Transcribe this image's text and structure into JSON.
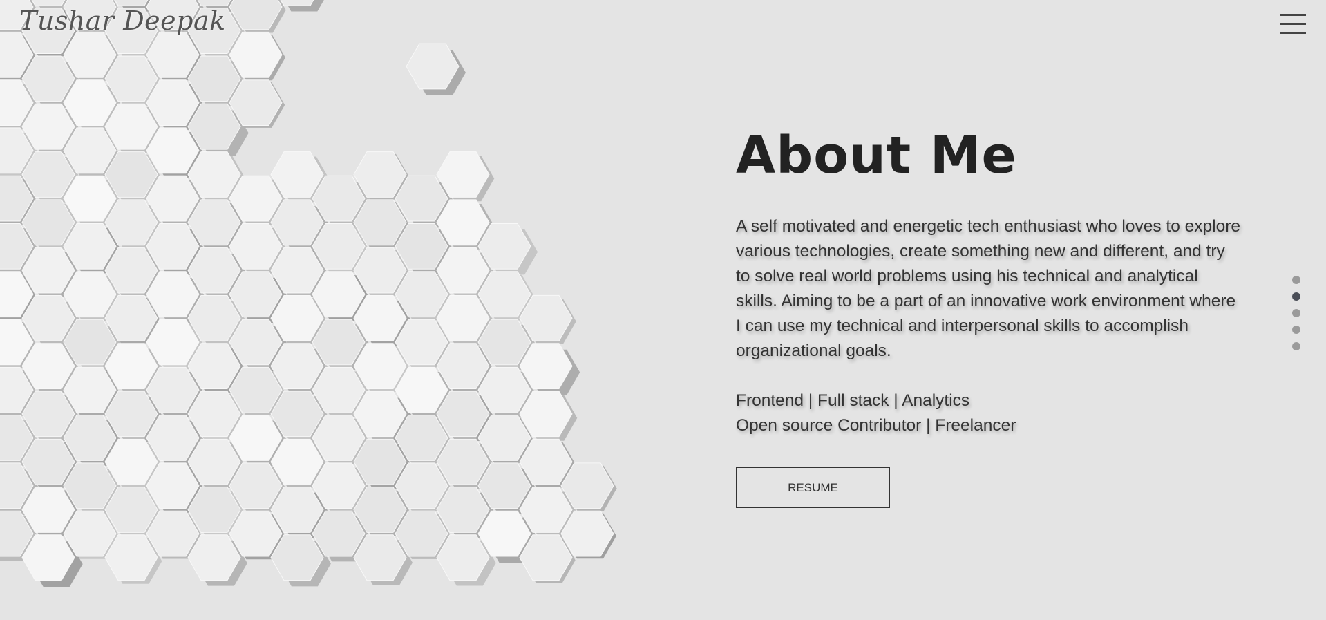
{
  "header": {
    "logo_text": "Tushar Deepak",
    "menu_icon": "hamburger-menu-icon"
  },
  "about": {
    "title": "About Me",
    "bio": "A self motivated and energetic tech enthusiast who loves to explore various technologies, create something new and different, and try to solve real world problems using his technical and analytical skills. Aiming to be a part of an innovative work environment where I can use my technical and interpersonal skills to accomplish organizational goals.",
    "roles": [
      "Frontend | Full stack | Analytics",
      "Open source Contributor | Freelancer"
    ],
    "resume_label": "RESUME"
  },
  "section_nav": {
    "count": 5,
    "active_index": 1
  },
  "colors": {
    "background": "#e4e4e4",
    "text": "#333333",
    "title": "#222222",
    "dot_inactive": "#9a9a9a",
    "dot_active": "#4a4e57"
  }
}
